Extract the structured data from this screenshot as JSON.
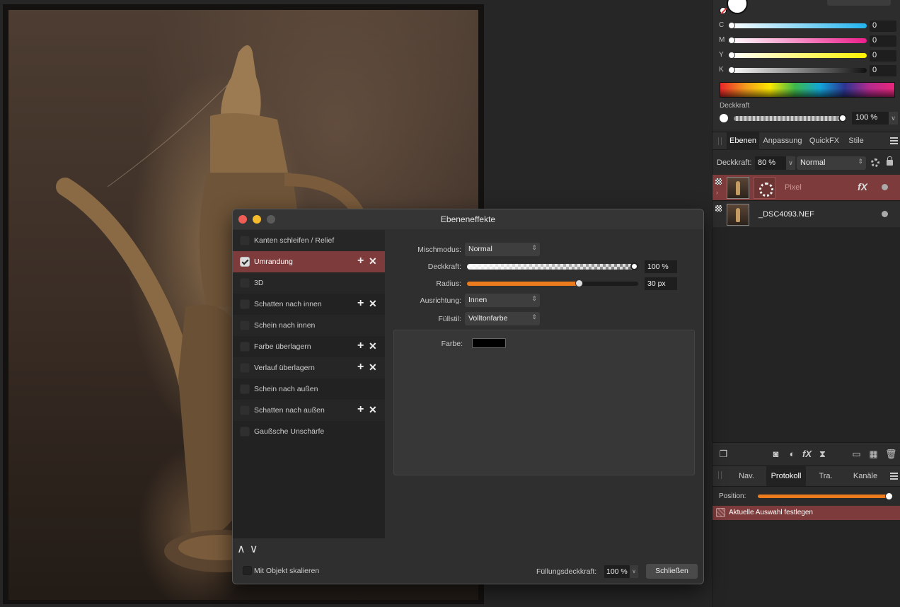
{
  "color_panel": {
    "channels": [
      {
        "label": "C",
        "value": "0",
        "gradient": "linear-gradient(90deg,#fff,#22b4ee)"
      },
      {
        "label": "M",
        "value": "0",
        "gradient": "linear-gradient(90deg,#fff,#ec1e8c)"
      },
      {
        "label": "Y",
        "value": "0",
        "gradient": "linear-gradient(90deg,#fff,#fff200)"
      },
      {
        "label": "K",
        "value": "0",
        "gradient": "linear-gradient(90deg,#fff,#111)"
      }
    ],
    "opacity_label": "Deckkraft",
    "opacity_value": "100 %"
  },
  "layers_panel": {
    "tabs": [
      "Ebenen",
      "Anpassung",
      "QuickFX",
      "Stile"
    ],
    "opacity_label": "Deckkraft:",
    "opacity_value": "80 %",
    "blend_mode": "Normal",
    "layers": [
      {
        "name": "Pixel",
        "selected": true
      },
      {
        "name": "_DSC4093.NEF",
        "selected": false
      }
    ]
  },
  "history_panel": {
    "tabs": [
      "Nav.",
      "Protokoll",
      "Tra.",
      "Kanäle"
    ],
    "position_label": "Position:",
    "position_fraction": 1.0,
    "items": [
      "Aktuelle Auswahl festlegen"
    ]
  },
  "dialog": {
    "title": "Ebeneneffekte",
    "effects": [
      {
        "label": "Kanten schleifen / Relief",
        "checked": false,
        "plus": false
      },
      {
        "label": "Umrandung",
        "checked": true,
        "plus": true
      },
      {
        "label": "3D",
        "checked": false,
        "plus": false
      },
      {
        "label": "Schatten nach innen",
        "checked": false,
        "plus": true
      },
      {
        "label": "Schein nach innen",
        "checked": false,
        "plus": false
      },
      {
        "label": "Farbe überlagern",
        "checked": false,
        "plus": true
      },
      {
        "label": "Verlauf überlagern",
        "checked": false,
        "plus": true
      },
      {
        "label": "Schein nach außen",
        "checked": false,
        "plus": false
      },
      {
        "label": "Schatten nach außen",
        "checked": false,
        "plus": true
      },
      {
        "label": "Gaußsche Unschärfe",
        "checked": false,
        "plus": false
      }
    ],
    "props": {
      "blend_label": "Mischmodus:",
      "blend_value": "Normal",
      "opacity_label": "Deckkraft:",
      "opacity_value": "100 %",
      "opacity_fraction": 1.0,
      "radius_label": "Radius:",
      "radius_value": "30 px",
      "radius_fraction": 0.65,
      "align_label": "Ausrichtung:",
      "align_value": "Innen",
      "fill_label": "Füllstil:",
      "fill_value": "Volltonfarbe",
      "color_label": "Farbe:",
      "color_value": "#000000"
    },
    "scale_label": "Mit Objekt skalieren",
    "fill_opacity_label": "Füllungsdeckkraft:",
    "fill_opacity_value": "100 %",
    "close_label": "Schließen"
  },
  "colors": {
    "accent": "#ec7b1d",
    "selection": "#7d3b3b"
  }
}
